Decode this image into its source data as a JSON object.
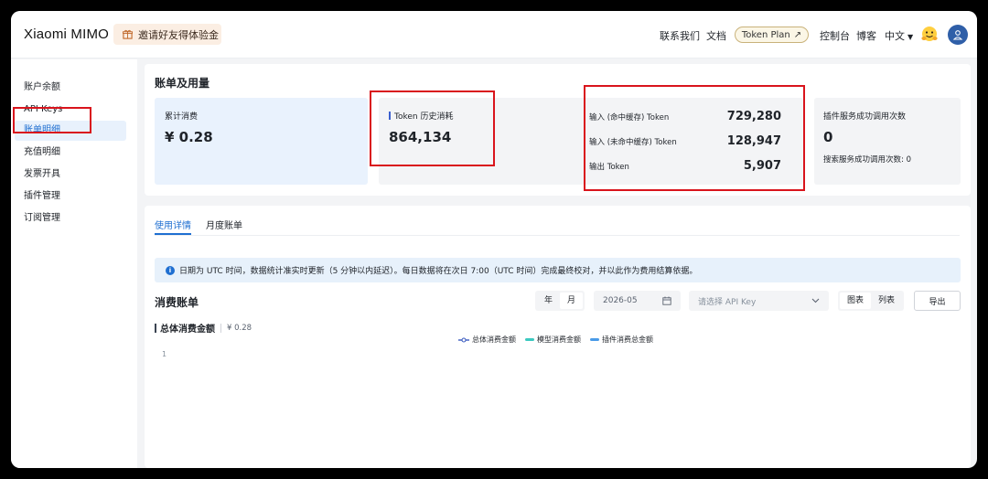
{
  "header": {
    "logo": "Xiaomi MIMO",
    "invite": "邀请好友得体验金",
    "nav": [
      "联系我们",
      "文档"
    ],
    "token_plan": "Token Plan",
    "console": "控制台",
    "blog": "博客",
    "language": "中文"
  },
  "sidebar": {
    "items": [
      {
        "label": "账户余额"
      },
      {
        "label": "API Keys"
      },
      {
        "label": "账单明细",
        "active": true
      },
      {
        "label": "充值明细"
      },
      {
        "label": "发票开具"
      },
      {
        "label": "插件管理"
      },
      {
        "label": "订阅管理"
      }
    ]
  },
  "summary": {
    "title": "账单及用量",
    "total_cost_label": "累计消费",
    "total_cost_value": "¥ 0.28",
    "token_history_label": "Token 历史消耗",
    "token_history_value": "864,134",
    "token_rows": [
      {
        "label": "输入 (命中缓存) Token",
        "value": "729,280",
        "color": "#3cc9a7"
      },
      {
        "label": "输入 (未命中缓存) Token",
        "value": "128,947",
        "color": "#3a86d9"
      },
      {
        "label": "输出 Token",
        "value": "5,907",
        "color": "#7fc6f2"
      }
    ],
    "plugin_label": "插件服务成功调用次数",
    "plugin_value": "0",
    "plugin_search": "搜索服务成功调用次数: 0"
  },
  "tabs": [
    {
      "label": "使用详情",
      "active": true
    },
    {
      "label": "月度账单"
    }
  ],
  "notice": "日期为 UTC 时间，数据统计准实时更新（5 分钟以内延迟）。每日数据将在次日 7:00（UTC 时间）完成最终校对，并以此作为费用结算依据。",
  "bill": {
    "title": "消费账单",
    "period_year": "年",
    "period_month": "月",
    "date_value": "2026-05",
    "api_key_placeholder": "请选择 API Key",
    "view_chart": "图表",
    "view_list": "列表",
    "export": "导出"
  },
  "chart_data": {
    "type": "line",
    "title": "总体消费金额",
    "subtitle": "¥ 0.28",
    "series": [
      {
        "name": "总体消费金额",
        "color": "#3b5bc0",
        "values": []
      },
      {
        "name": "模型消费金额",
        "color": "#3cc9c0",
        "values": []
      },
      {
        "name": "插件消费总金额",
        "color": "#4a9be8",
        "values": []
      }
    ],
    "y_ticks": [
      "1"
    ]
  }
}
